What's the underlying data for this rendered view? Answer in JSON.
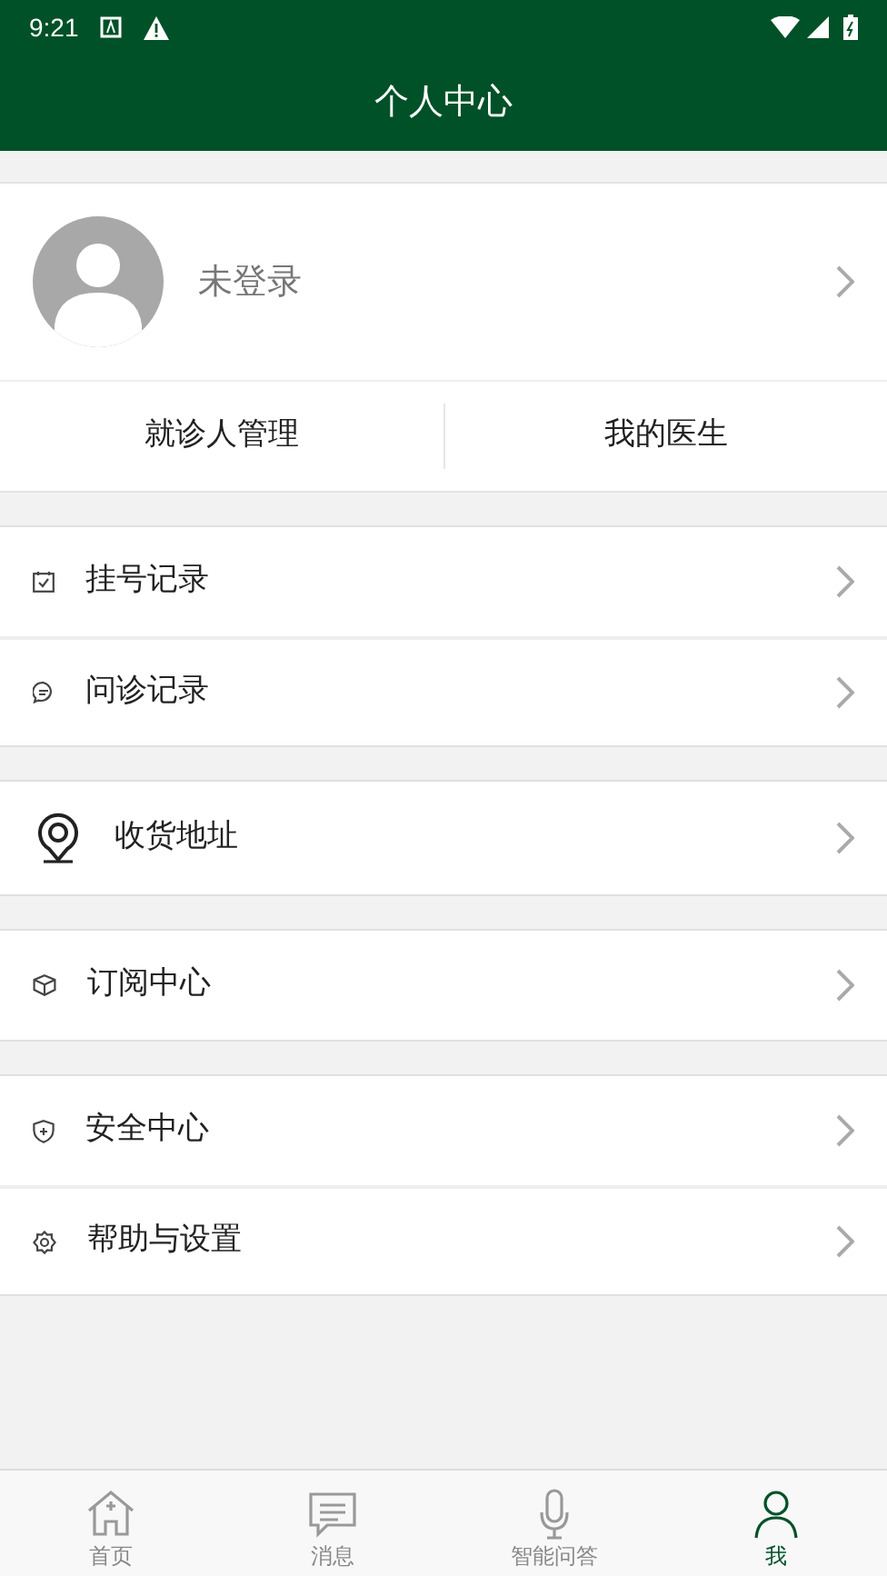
{
  "status_bar": {
    "time": "9:21"
  },
  "header": {
    "title": "个人中心"
  },
  "profile": {
    "name": "未登录"
  },
  "profile_links": [
    "就诊人管理",
    "我的医生"
  ],
  "menu_groups": [
    [
      {
        "label": "挂号记录",
        "kind": "calendar"
      },
      {
        "label": "问诊记录",
        "kind": "chat"
      }
    ],
    [
      {
        "label": "收货地址",
        "kind": "pin"
      }
    ],
    [
      {
        "label": "订阅中心",
        "kind": "box"
      }
    ],
    [
      {
        "label": "安全中心",
        "kind": "shield"
      },
      {
        "label": "帮助与设置",
        "kind": "gear"
      }
    ]
  ],
  "tabs": [
    {
      "label": "首页",
      "kind": "home",
      "selected": false
    },
    {
      "label": "消息",
      "kind": "message",
      "selected": false
    },
    {
      "label": "智能问答",
      "kind": "mic",
      "selected": false
    },
    {
      "label": "我",
      "kind": "person",
      "selected": true
    }
  ]
}
